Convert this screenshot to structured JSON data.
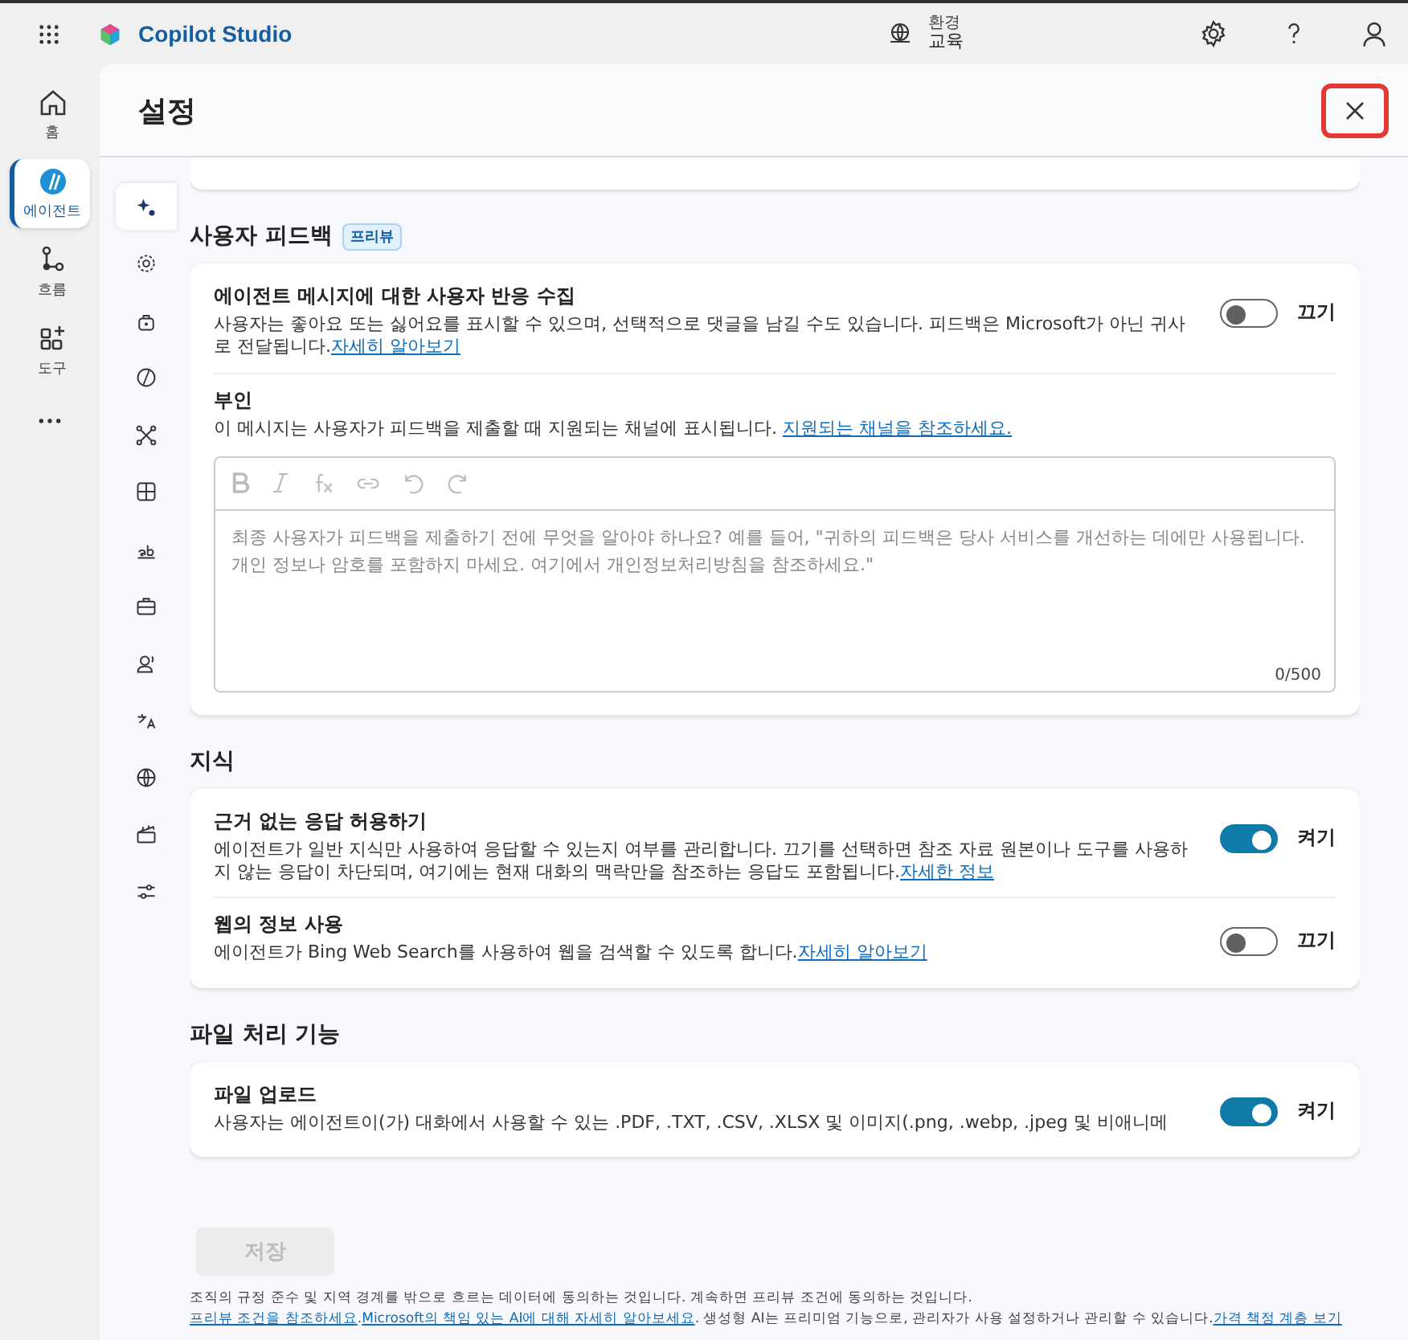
{
  "app": {
    "name": "Copilot Studio"
  },
  "environment": {
    "label": "환경",
    "value": "교육"
  },
  "rail": [
    {
      "kind": "home",
      "label": "홈",
      "selected": false
    },
    {
      "kind": "agent",
      "label": "에이전트",
      "selected": true
    },
    {
      "kind": "flow",
      "label": "흐름",
      "selected": false
    },
    {
      "kind": "tools",
      "label": "도구",
      "selected": false
    }
  ],
  "settings": {
    "title": "설정"
  },
  "subnav": [
    {
      "kind": "sparkle",
      "selected": true
    },
    {
      "kind": "gear",
      "selected": false
    },
    {
      "kind": "bag",
      "selected": false
    },
    {
      "kind": "slash",
      "selected": false
    },
    {
      "kind": "network",
      "selected": false
    },
    {
      "kind": "grid",
      "selected": false
    },
    {
      "kind": "text",
      "selected": false
    },
    {
      "kind": "briefcase",
      "selected": false
    },
    {
      "kind": "voice",
      "selected": false
    },
    {
      "kind": "translate",
      "selected": false
    },
    {
      "kind": "globe",
      "selected": false
    },
    {
      "kind": "clapper",
      "selected": false
    },
    {
      "kind": "sliders",
      "selected": false
    }
  ],
  "sections": [
    {
      "title": "사용자 피드백",
      "badge": "프리뷰",
      "items": [
        {
          "kind": "toggle",
          "title": "에이전트 메시지에 대한 사용자 반응 수집",
          "description": "사용자는 좋아요 또는 싫어요를 표시할 수 있으며, 선택적으로 댓글을 남길 수도 있습니다. 피드백은 Microsoft가 아닌 귀사로 전달됩니다.",
          "link": "자세히 알아보기",
          "on": false,
          "state_label": "끄기"
        },
        {
          "kind": "textarea",
          "title": "부인",
          "description": "이 메시지는 사용자가 피드백을 제출할 때 지원되는 채널에 표시됩니다.",
          "link": "지원되는 채널을 참조하세요.",
          "placeholder": "최종 사용자가 피드백을 제출하기 전에 무엇을 알아야 하나요? 예를 들어, \"귀하의 피드백은 당사 서비스를 개선하는 데에만 사용됩니다. 개인 정보나 암호를 포함하지 마세요. 여기에서 개인정보처리방침을 참조하세요.\"",
          "counter": "0/500"
        }
      ]
    },
    {
      "title": "지식",
      "items": [
        {
          "kind": "toggle",
          "title": "근거 없는 응답 허용하기",
          "description": "에이전트가 일반 지식만 사용하여 응답할 수 있는지 여부를 관리합니다. 끄기를 선택하면 참조 자료 원본이나 도구를 사용하지 않는 응답이 차단되며, 여기에는 현재 대화의 맥락만을 참조하는 응답도 포함됩니다.",
          "link": "자세한 정보",
          "on": true,
          "state_label": "켜기"
        },
        {
          "kind": "toggle",
          "title": "웹의 정보 사용",
          "description": "에이전트가 Bing Web Search를 사용하여 웹을 검색할 수 있도록 합니다.",
          "link": "자세히 알아보기",
          "on": false,
          "state_label": "끄기"
        }
      ]
    },
    {
      "title": "파일 처리 기능",
      "items": [
        {
          "kind": "toggle",
          "title": "파일 업로드",
          "description": "사용자는 에이전트이(가) 대화에서 사용할 수 있는 .PDF, .TXT, .CSV, .XLSX 및 이미지(.png, .webp, .jpeg 및 비애니메",
          "on": true,
          "state_label": "켜기"
        }
      ]
    }
  ],
  "save": {
    "label": "저장",
    "disabled": true
  },
  "legal": [
    {
      "text": "조직의 규정 준수 및 지역 경계를 밖으로 흐르는 데이터에 동의하는 것입니다. 계속하면 프리뷰 조건에 동의하는 것입니다.",
      "link": false
    },
    {
      "text": "프리뷰 조건을 참조하세요",
      "link": true
    },
    {
      "text": ".",
      "link": false
    },
    {
      "text": "Microsoft의 책임 있는 AI에 대해 자세히 알아보세요",
      "link": true
    },
    {
      "text": ". 생성형 AI는 프리미엄 기능으로, 관리자가 사용 설정하거나 관리할 수 있습니다.",
      "link": false
    },
    {
      "text": "가격 책정 계층 보기",
      "link": true
    }
  ]
}
